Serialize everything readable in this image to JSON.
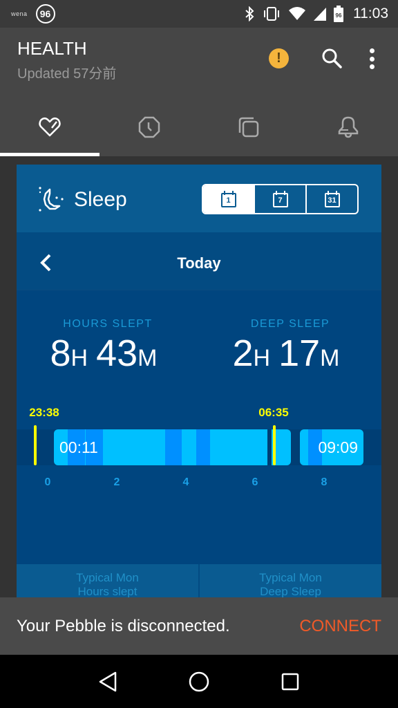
{
  "status_bar": {
    "brand": "wena",
    "badge": "96",
    "battery_level": "96",
    "time": "11:03"
  },
  "app_bar": {
    "title": "HEALTH",
    "subtitle": "Updated 57分前",
    "warning_symbol": "!"
  },
  "tabs": [
    {
      "name": "health",
      "icon": "heart-icon",
      "active": true
    },
    {
      "name": "watch",
      "icon": "clock-icon",
      "active": false
    },
    {
      "name": "apps",
      "icon": "stack-icon",
      "active": false
    },
    {
      "name": "notifications",
      "icon": "bell-icon",
      "active": false
    }
  ],
  "card": {
    "title": "Sleep",
    "ranges": [
      {
        "label": "1",
        "active": true
      },
      {
        "label": "7",
        "active": false
      },
      {
        "label": "31",
        "active": false
      }
    ],
    "date_label": "Today",
    "stats": [
      {
        "label": "HOURS SLEPT",
        "hours": "8",
        "hours_unit": "H",
        "minutes": "43",
        "minutes_unit": "M"
      },
      {
        "label": "DEEP SLEEP",
        "hours": "2",
        "hours_unit": "H",
        "minutes": "17",
        "minutes_unit": "M"
      }
    ],
    "timeline": {
      "typical_start": "23:38",
      "typical_end": "06:35",
      "start_time": "00:11",
      "end_time": "09:09",
      "axis_ticks": [
        "0",
        "2",
        "4",
        "6",
        "8"
      ]
    },
    "typical": [
      {
        "line1": "Typical Mon",
        "line2": "Hours slept"
      },
      {
        "line1": "Typical Mon",
        "line2": "Deep Sleep"
      }
    ]
  },
  "snackbar": {
    "message": "Your Pebble is disconnected.",
    "action": "CONNECT"
  },
  "colors": {
    "accent_warning": "#f4b43c",
    "connect": "#f05a28",
    "light_sleep": "#00c0ff",
    "deep_sleep": "#0090ff",
    "marker": "#ffff00"
  }
}
